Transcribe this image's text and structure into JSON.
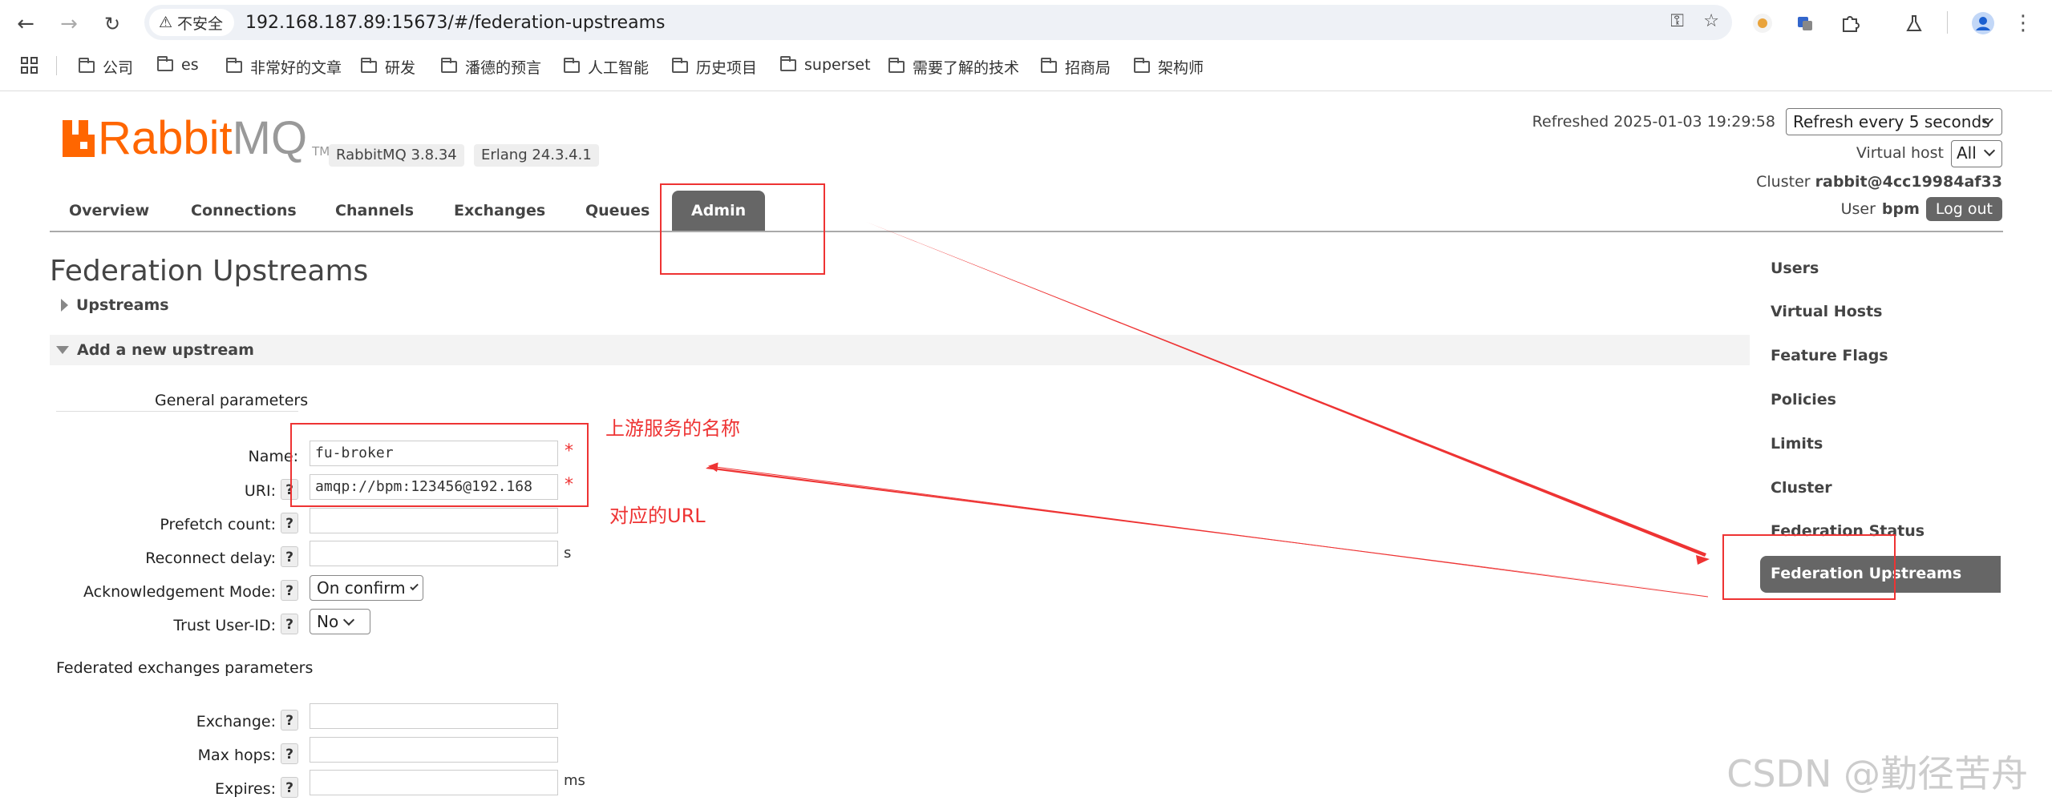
{
  "browser": {
    "insecure_label": "不安全",
    "url": "192.168.187.89:15673/#/federation-upstreams",
    "bookmarks": [
      "公司",
      "es",
      "非常好的文章",
      "研发",
      "潘德的预言",
      "人工智能",
      "历史项目",
      "superset",
      "需要了解的技术",
      "招商局",
      "架构师"
    ]
  },
  "header": {
    "logo_rabbit": "Rabbit",
    "logo_mq": "MQ",
    "logo_tm": "TM",
    "rabbitmq_version": "RabbitMQ 3.8.34",
    "erlang_version": "Erlang 24.3.4.1",
    "refreshed": "Refreshed 2025-01-03 19:29:58",
    "refresh_option": "Refresh every 5 seconds",
    "virtual_host_label": "Virtual host",
    "virtual_host_value": "All",
    "cluster_label": "Cluster",
    "cluster_name": "rabbit@4cc19984af33",
    "user_label": "User",
    "user_name": "bpm",
    "logout": "Log out"
  },
  "tabs": [
    "Overview",
    "Connections",
    "Channels",
    "Exchanges",
    "Queues",
    "Admin"
  ],
  "active_tab": "Admin",
  "main": {
    "title": "Federation Upstreams",
    "upstreams_section": "Upstreams",
    "add_section": "Add a new upstream",
    "general_group": "General parameters",
    "federated_group": "Federated exchanges parameters",
    "help": "?",
    "required": "*",
    "fields": {
      "name_label": "Name:",
      "name_value": "fu-broker",
      "uri_label": "URI:",
      "uri_value": "amqp://bpm:123456@192.168",
      "prefetch_label": "Prefetch count:",
      "reconnect_label": "Reconnect delay:",
      "reconnect_unit": "s",
      "ack_label": "Acknowledgement Mode:",
      "ack_value": "On confirm",
      "trust_label": "Trust User-ID:",
      "trust_value": "No",
      "exchange_label": "Exchange:",
      "maxhops_label": "Max hops:",
      "expires_label": "Expires:",
      "expires_unit": "ms"
    }
  },
  "sidebar": [
    "Users",
    "Virtual Hosts",
    "Feature Flags",
    "Policies",
    "Limits",
    "Cluster",
    "Federation Status",
    "Federation Upstreams"
  ],
  "annotations": {
    "name_note": "上游服务的名称",
    "url_note": "对应的URL",
    "color": "#e33333"
  },
  "watermark": "CSDN @勤径苦舟"
}
